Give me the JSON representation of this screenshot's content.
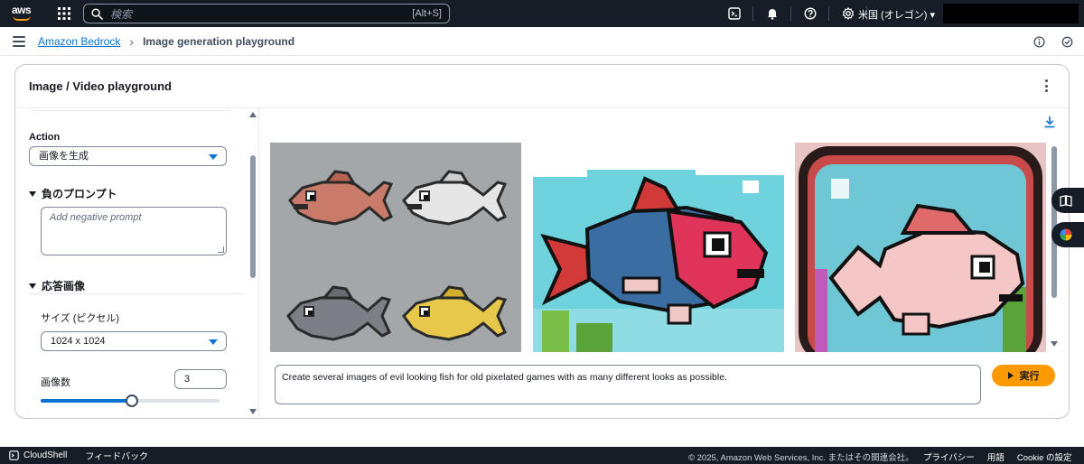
{
  "topnav": {
    "logo_text": "aws",
    "search_placeholder": "検索",
    "search_shortcut": "[Alt+S]",
    "region": "米国 (オレゴン) ▾",
    "icons": [
      "cloudshell-icon",
      "bell-icon",
      "help-icon",
      "settings-icon"
    ]
  },
  "breadcrumb": {
    "link": "Amazon Bedrock",
    "separator": "›",
    "current": "Image generation playground"
  },
  "card": {
    "title": "Image / Video playground"
  },
  "left_panel": {
    "action_label": "Action",
    "action_value": "画像を生成",
    "negative_section": "負のプロンプト",
    "negative_placeholder": "Add negative prompt",
    "response_section": "応答画像",
    "size_label": "サイズ (ピクセル)",
    "size_value": "1024 x 1024",
    "count_label": "画像数",
    "count_value": "3",
    "count_slider_fraction": 0.51
  },
  "right_panel": {
    "prompt": "Create several images of evil looking fish for old pixelated games with as many different looks as possible.",
    "run_label": "実行",
    "images": [
      "fish-grid-image",
      "fish-blue-red-image",
      "fish-pink-frame-image"
    ]
  },
  "footer": {
    "cloudshell": "CloudShell",
    "feedback": "フィードバック",
    "copyright": "© 2025, Amazon Web Services, Inc. またはその関連会社。",
    "links": [
      "プライバシー",
      "用語",
      "Cookie の設定"
    ]
  },
  "colors": {
    "nav_bg": "#161d26",
    "link": "#0972d3",
    "primary_button": "#ff9900",
    "border": "#7d8998"
  }
}
